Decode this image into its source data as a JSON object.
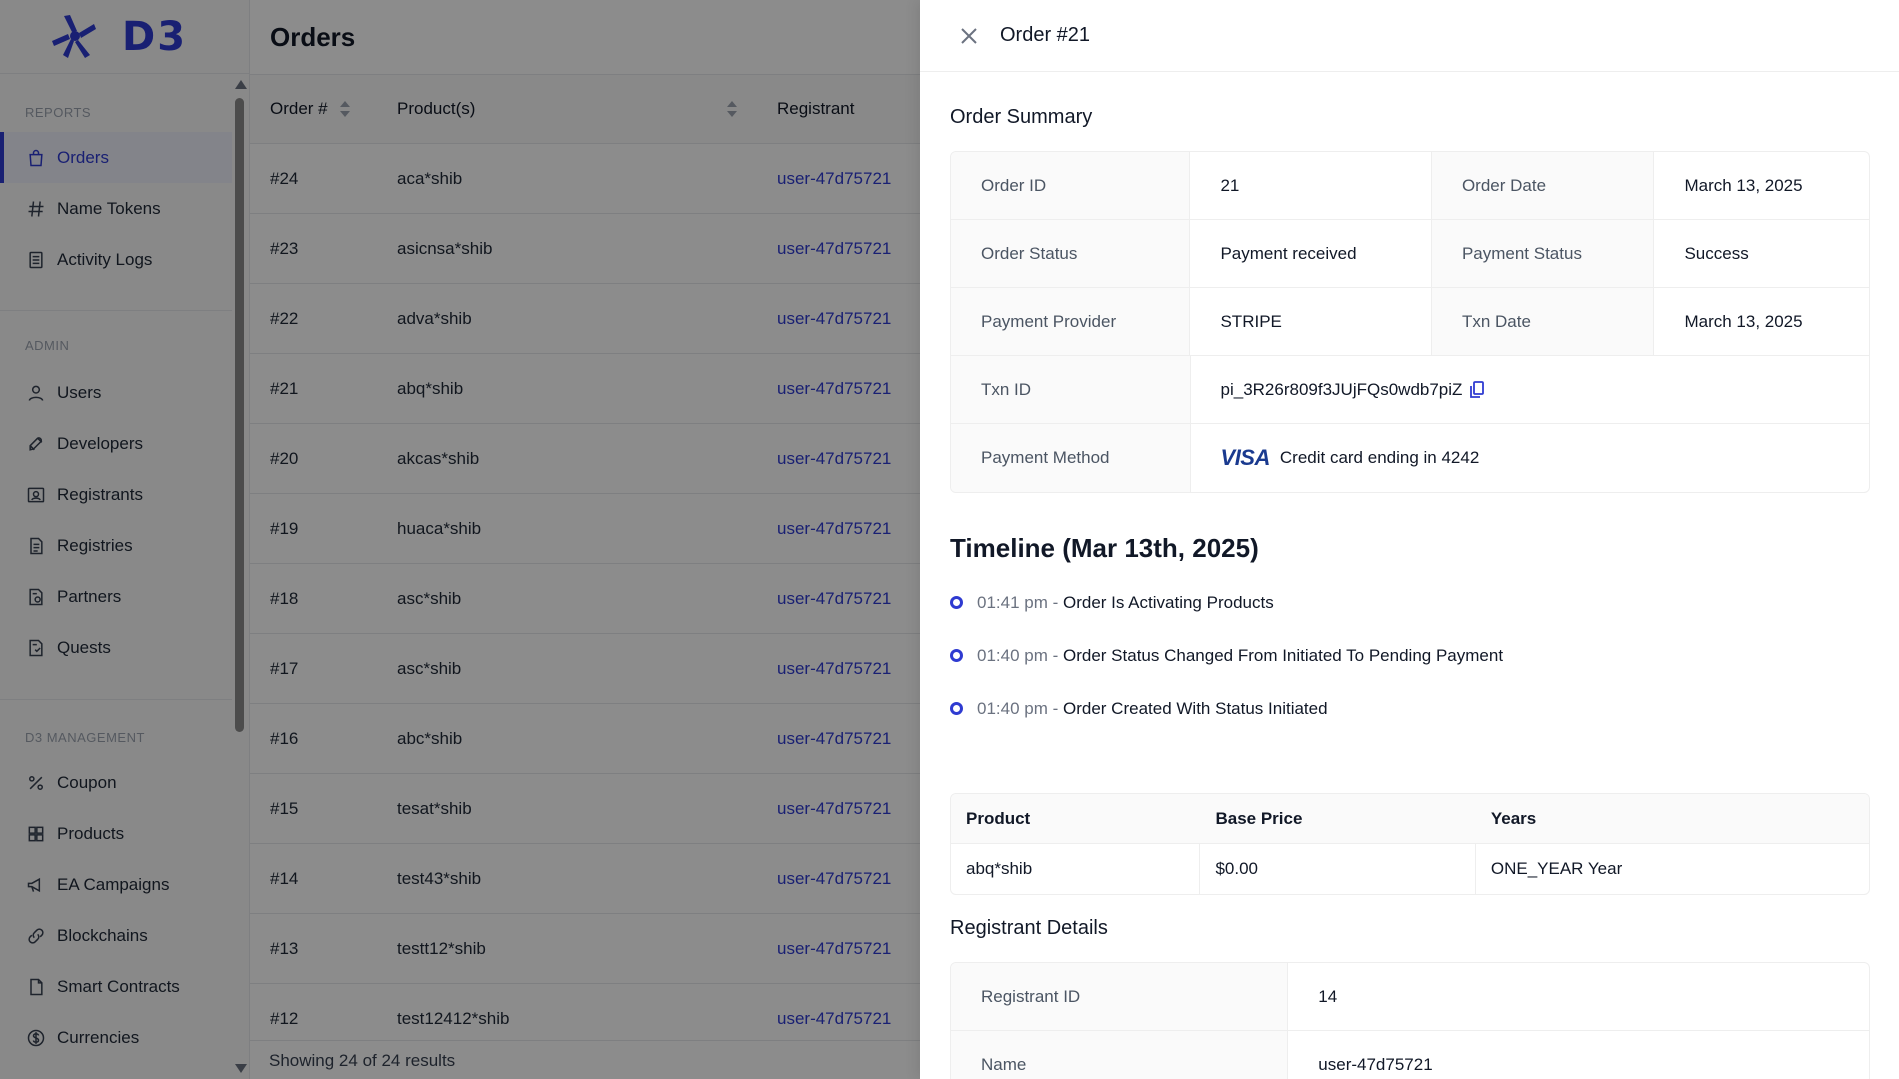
{
  "brand": {
    "name": "D3",
    "color": "#2f3bd1"
  },
  "sidebar": {
    "sections": [
      {
        "label": "REPORTS",
        "items": [
          {
            "label": "Orders",
            "icon": "shopping-bag-icon",
            "active": true
          },
          {
            "label": "Name Tokens",
            "icon": "hash-icon"
          },
          {
            "label": "Activity Logs",
            "icon": "list-icon"
          }
        ]
      },
      {
        "label": "ADMIN",
        "items": [
          {
            "label": "Users",
            "icon": "user-icon"
          },
          {
            "label": "Developers",
            "icon": "rocket-icon"
          },
          {
            "label": "Registrants",
            "icon": "id-card-icon"
          },
          {
            "label": "Registries",
            "icon": "file-icon"
          },
          {
            "label": "Partners",
            "icon": "partner-file-icon"
          },
          {
            "label": "Quests",
            "icon": "quest-file-icon"
          }
        ]
      },
      {
        "label": "D3 MANAGEMENT",
        "items": [
          {
            "label": "Coupon",
            "icon": "percent-icon"
          },
          {
            "label": "Products",
            "icon": "grid-icon"
          },
          {
            "label": "EA Campaigns",
            "icon": "megaphone-icon"
          },
          {
            "label": "Blockchains",
            "icon": "link-icon"
          },
          {
            "label": "Smart Contracts",
            "icon": "document-icon"
          },
          {
            "label": "Currencies",
            "icon": "dollar-circle-icon"
          }
        ]
      }
    ]
  },
  "main": {
    "title": "Orders",
    "columns": {
      "order": "Order #",
      "products": "Product(s)",
      "registrant": "Registrant"
    },
    "rows": [
      {
        "order": "#24",
        "product": "aca*shib",
        "registrant": "user-47d75721"
      },
      {
        "order": "#23",
        "product": "asicnsa*shib",
        "registrant": "user-47d75721"
      },
      {
        "order": "#22",
        "product": "adva*shib",
        "registrant": "user-47d75721"
      },
      {
        "order": "#21",
        "product": "abq*shib",
        "registrant": "user-47d75721"
      },
      {
        "order": "#20",
        "product": "akcas*shib",
        "registrant": "user-47d75721"
      },
      {
        "order": "#19",
        "product": "huaca*shib",
        "registrant": "user-47d75721"
      },
      {
        "order": "#18",
        "product": "asc*shib",
        "registrant": "user-47d75721"
      },
      {
        "order": "#17",
        "product": "asc*shib",
        "registrant": "user-47d75721"
      },
      {
        "order": "#16",
        "product": "abc*shib",
        "registrant": "user-47d75721"
      },
      {
        "order": "#15",
        "product": "tesat*shib",
        "registrant": "user-47d75721"
      },
      {
        "order": "#14",
        "product": "test43*shib",
        "registrant": "user-47d75721"
      },
      {
        "order": "#13",
        "product": "testt12*shib",
        "registrant": "user-47d75721"
      },
      {
        "order": "#12",
        "product": "test12412*shib",
        "registrant": "user-47d75721"
      }
    ],
    "footer": "Showing 24 of 24 results"
  },
  "drawer": {
    "title": "Order #21",
    "summary_heading": "Order Summary",
    "summary": {
      "order_id_label": "Order ID",
      "order_id": "21",
      "order_date_label": "Order Date",
      "order_date": "March 13, 2025",
      "order_status_label": "Order Status",
      "order_status": "Payment received",
      "payment_status_label": "Payment Status",
      "payment_status": "Success",
      "payment_provider_label": "Payment Provider",
      "payment_provider": "STRIPE",
      "txn_date_label": "Txn Date",
      "txn_date": "March 13, 2025",
      "txn_id_label": "Txn ID",
      "txn_id": "pi_3R26r809f3JUjFQs0wdb7piZ",
      "payment_method_label": "Payment Method",
      "card_brand": "VISA",
      "payment_method": "Credit card ending in 4242"
    },
    "timeline_heading": "Timeline (Mar 13th, 2025)",
    "timeline": [
      {
        "time": "01:41 pm",
        "sep": " - ",
        "text": "Order Is Activating Products"
      },
      {
        "time": "01:40 pm",
        "sep": " - ",
        "text": "Order Status Changed From Initiated To Pending Payment"
      },
      {
        "time": "01:40 pm",
        "sep": " - ",
        "text": "Order Created With Status Initiated"
      }
    ],
    "products_table": {
      "headers": {
        "product": "Product",
        "base_price": "Base Price",
        "years": "Years"
      },
      "rows": [
        {
          "product": "abq*shib",
          "base_price": "$0.00",
          "years": "ONE_YEAR Year"
        }
      ]
    },
    "registrant_heading": "Registrant Details",
    "registrant": {
      "id_label": "Registrant ID",
      "id": "14",
      "name_label": "Name",
      "name": "user-47d75721"
    }
  }
}
